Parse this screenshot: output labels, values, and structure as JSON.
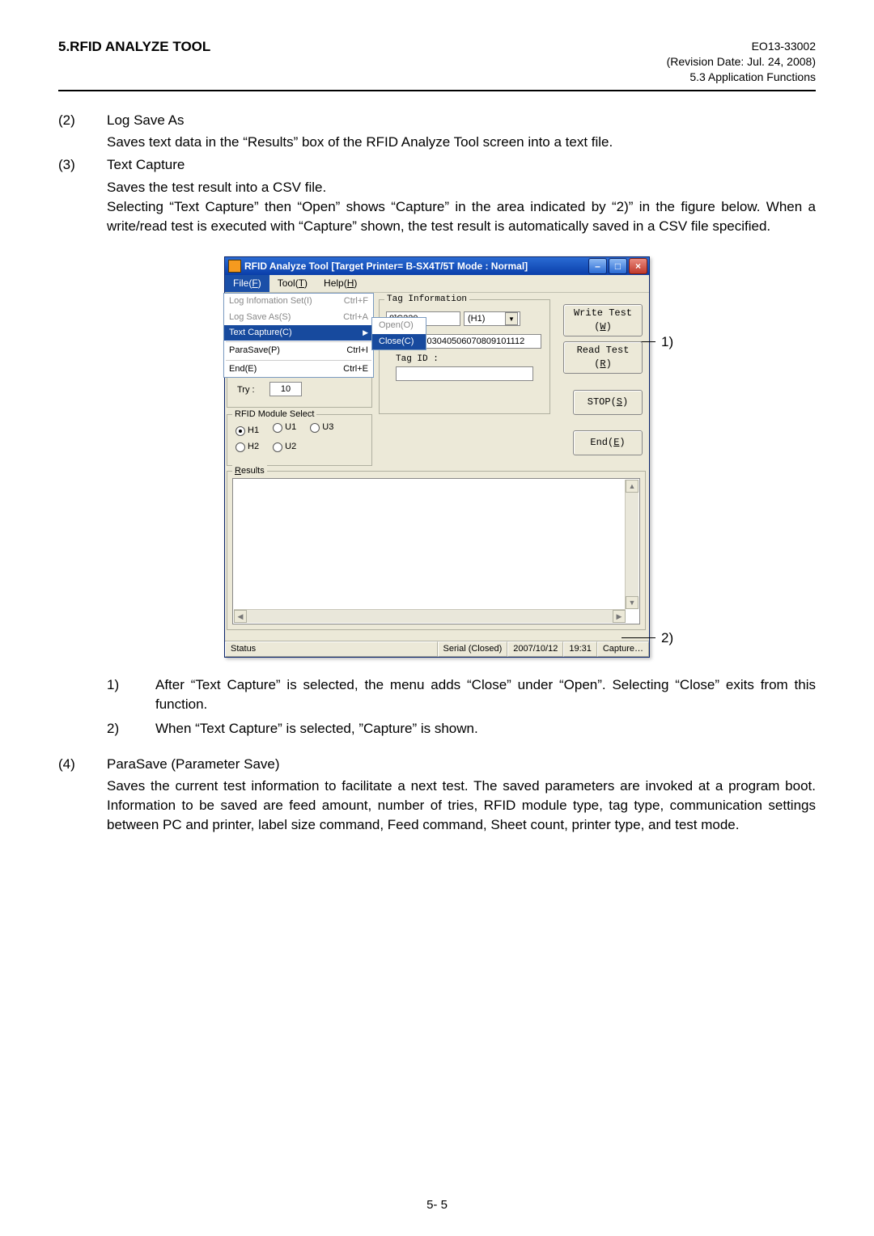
{
  "header": {
    "left": "5.RFID ANALYZE TOOL",
    "right_code": "EO13-33002",
    "right_rev": "(Revision Date: Jul. 24, 2008)",
    "right_sec": "5.3 Application Functions"
  },
  "items": {
    "i2_num": "(2)",
    "i2_title": "Log Save As",
    "i2_text": "Saves text data in the “Results” box of the RFID Analyze Tool screen into a text file.",
    "i3_num": "(3)",
    "i3_title": "Text Capture",
    "i3_l1": "Saves the test result into a CSV file.",
    "i3_l2": "Selecting “Text Capture” then “Open” shows “Capture” in the area indicated by “2)” in the figure below.  When a write/read test is executed with “Capture” shown, the test result is automatically saved in a CSV file specified.",
    "after_sub1_num": "1)",
    "after_sub1_text": "After “Text Capture” is selected, the menu adds “Close” under “Open”.  Selecting “Close” exits from this function.",
    "after_sub2_num": "2)",
    "after_sub2_text": "When “Text Capture” is selected, ”Capture” is shown.",
    "i4_num": "(4)",
    "i4_title": "ParaSave (Parameter Save)",
    "i4_text": "Saves the current test information to facilitate a next test.  The saved parameters are invoked at a program boot.  Information to be saved are feed amount, number of tries, RFID module type, tag type, communication settings between PC and printer, label size command, Feed command, Sheet count, printer type, and test mode."
  },
  "window": {
    "title": "RFID Analyze Tool [Target Printer= B-SX4T/5T Mode : Normal]",
    "menus": {
      "file": "File(F)",
      "tool": "Tool(T)",
      "help": "Help(H)"
    },
    "dropdown": {
      "loginfo": "Log Infomation Set(I)",
      "loginfo_sc": "Ctrl+F",
      "logsave": "Log Save As(S)",
      "logsave_sc": "Ctrl+A",
      "textcap": "Text Capture(C)",
      "parasave": "ParaSave(P)",
      "parasave_sc": "Ctrl+I",
      "end": "End(E)",
      "end_sc": "Ctrl+E"
    },
    "submenu": {
      "open": "Open(O)",
      "close": "Close(C)"
    },
    "try_label": "Try :",
    "try_value": "10",
    "rfid_label": "RFID Module Select",
    "radios": {
      "h1": "H1",
      "u1": "U1",
      "u3": "U3",
      "h2": "H2",
      "u2": "U2"
    },
    "taginfo": {
      "label": "Tag Information",
      "typeval": "8]C220",
      "hval": "(H1)",
      "datavalue": "300003040506070809101112",
      "tagid_label": "Tag ID :"
    },
    "btns": {
      "write": "Write Test",
      "write_u": "(W)",
      "read": "Read Test",
      "read_u": "(R)",
      "stop": "STOP(S)",
      "end": "End(E)"
    },
    "results_label": "Results",
    "status": {
      "p1": "Status",
      "p2": "Serial (Closed)",
      "p3": "2007/10/12",
      "p4": "19:31",
      "p5": "Capture…"
    }
  },
  "callouts": {
    "c1": "1)",
    "c2": "2)"
  },
  "footer": "5- 5"
}
